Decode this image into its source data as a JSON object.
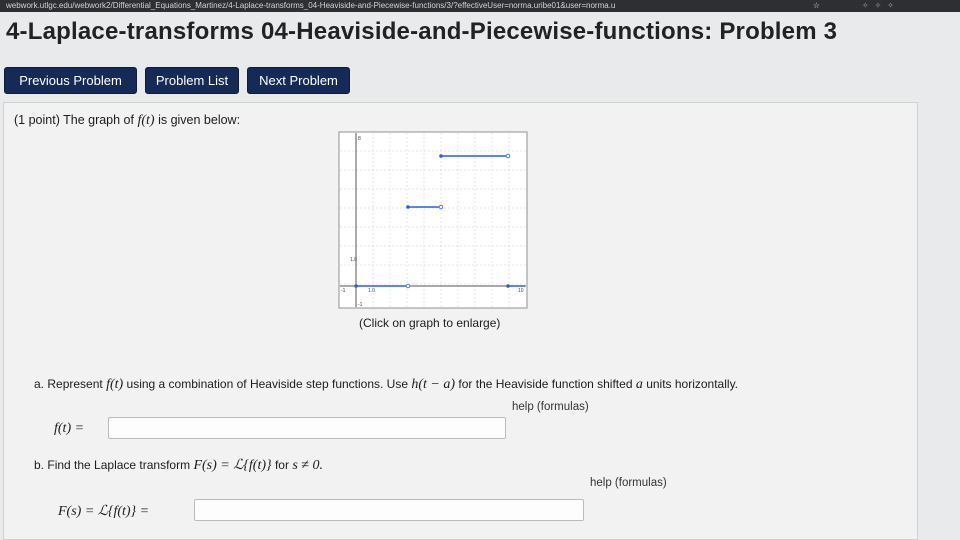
{
  "browser": {
    "url": "webwork.utlgc.edu/webwork2/Differential_Equations_Martinez/4-Laplace-transforms_04-Heaviside-and-Piecewise-functions/3/?effectiveUser=norma.uribe01&user=norma.u"
  },
  "page": {
    "title": "4-Laplace-transforms 04-Heaviside-and-Piecewise-functions: Problem 3"
  },
  "nav": {
    "previous": "Previous Problem",
    "list": "Problem List",
    "next": "Next Problem"
  },
  "problem": {
    "intro_points": "(1 point) The graph of",
    "intro_fn": "f(t)",
    "intro_tail": "is given below:",
    "graph_caption": "(Click on graph to enlarge)",
    "graph_labels": {
      "y_top": "8",
      "y_tick": "1.0",
      "x_tick": "1.0",
      "x_left": "-1",
      "x_right": "10",
      "y_bottom": "-1"
    },
    "part_a": {
      "letter": "a.",
      "text1": "Represent",
      "fn": "f(t)",
      "text2": "using a combination of Heaviside step functions. Use",
      "h": "h(t − a)",
      "text3": "for the Heaviside function shifted",
      "a": "a",
      "text4": "units horizontally.",
      "label": "f(t) =",
      "help": "help (formulas)"
    },
    "part_b": {
      "letter": "b.",
      "text1": "Find the Laplace transform",
      "formula": "F(s) = ℒ{f(t)}",
      "text2": "for",
      "cond": "s ≠ 0.",
      "label": "F(s) = ℒ{f(t)} =",
      "help": "help (formulas)"
    }
  },
  "colors": {
    "nav_button": "#152a56",
    "graph_line": "#2b5fd9"
  }
}
